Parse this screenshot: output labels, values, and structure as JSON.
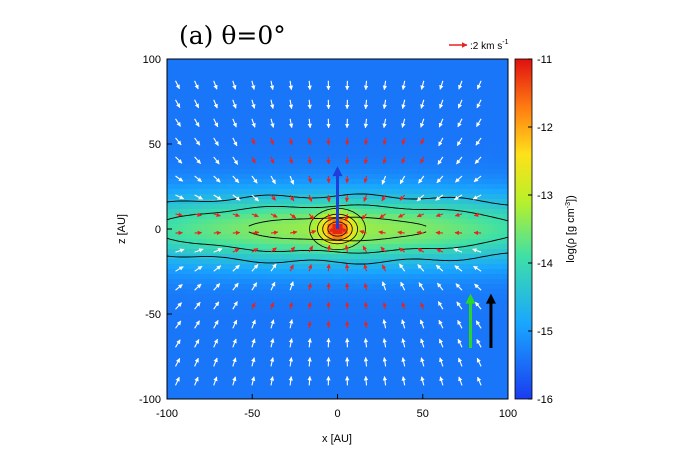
{
  "chart_data": {
    "type": "heatmap",
    "title": "(a) θ=0°",
    "xlabel": "x [AU]",
    "ylabel": "z [AU]",
    "xlim": [
      -100,
      100
    ],
    "ylim": [
      -100,
      100
    ],
    "x_ticks": [
      "-100",
      "-50",
      "0",
      "50",
      "100"
    ],
    "y_ticks": [
      "-100",
      "-50",
      "0",
      "50",
      "100"
    ],
    "colorbar": {
      "label": "log(ρ [g cm-3])",
      "min": -16,
      "max": -11,
      "ticks": [
        "-11",
        "-12",
        "-13",
        "-14",
        "-15",
        "-16"
      ]
    },
    "vector_legend": {
      "label": ":2 km s",
      "superscript": "-1",
      "color": "#e8231f"
    },
    "density_model": {
      "background_log_rho": -15.4,
      "disk_peak_log_rho": -13.3,
      "disk_scale_height_au": 15,
      "disk_radial_scale_au": 120,
      "core_peak_log_rho": -11.0,
      "core_scale_au": 6
    },
    "contours_log_rho": [
      -14.5,
      -14.0,
      -13.5,
      -13.0,
      -12.5,
      -12.0,
      -11.5
    ],
    "arrows_annotation": [
      {
        "name": "blue-arrow",
        "x": 0,
        "z_from": 0,
        "z_to": 37,
        "color": "#1f3fd8"
      },
      {
        "name": "green-arrow",
        "x": 78,
        "z_from": -70,
        "z_to": -38,
        "color": "#2bd62b"
      },
      {
        "name": "black-arrow",
        "x": 90,
        "z_from": -70,
        "z_to": -38,
        "color": "#000000"
      }
    ],
    "grid": false
  }
}
